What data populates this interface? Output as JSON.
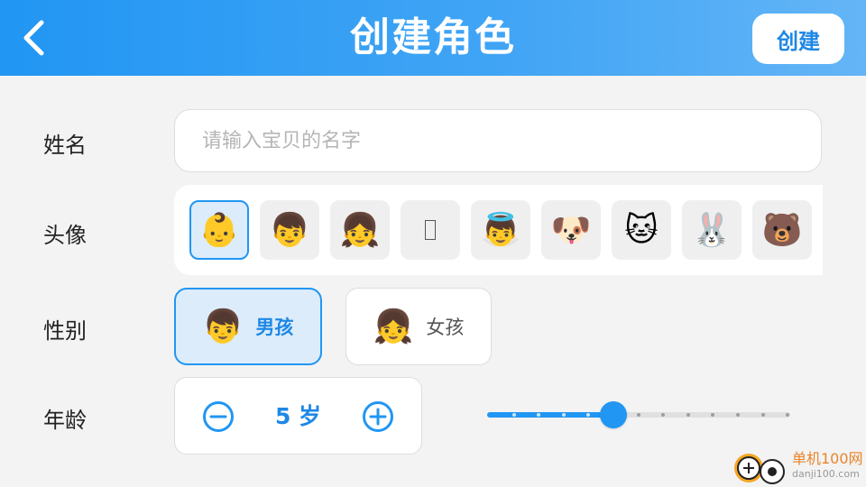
{
  "header": {
    "title": "创建角色",
    "create_label": "创建",
    "back_icon": "chevron-left-icon"
  },
  "form": {
    "name": {
      "label": "姓名",
      "value": "",
      "placeholder": "请输入宝贝的名字"
    },
    "avatar": {
      "label": "头像",
      "selected_index": 0,
      "options": [
        "👶",
        "👦",
        "👧",
        "",
        "👼",
        "🐶",
        "🐱",
        "🐰",
        "🐻"
      ]
    },
    "gender": {
      "label": "性别",
      "selected": "boy",
      "boy": {
        "label": "男孩",
        "emoji": "👦"
      },
      "girl": {
        "label": "女孩",
        "emoji": "👧"
      }
    },
    "age": {
      "label": "年龄",
      "display": "5 岁",
      "value": 5,
      "min": 1,
      "max": 12,
      "decrease_icon": "minus-circle-icon",
      "increase_icon": "plus-circle-icon"
    }
  },
  "watermark": {
    "text": "单机100网",
    "url": "danji100.com"
  },
  "colors": {
    "primary": "#2196f3",
    "header_gradient_end": "#64b5f6",
    "selected_bg": "#dcecfb",
    "background": "#f3f3f3"
  }
}
